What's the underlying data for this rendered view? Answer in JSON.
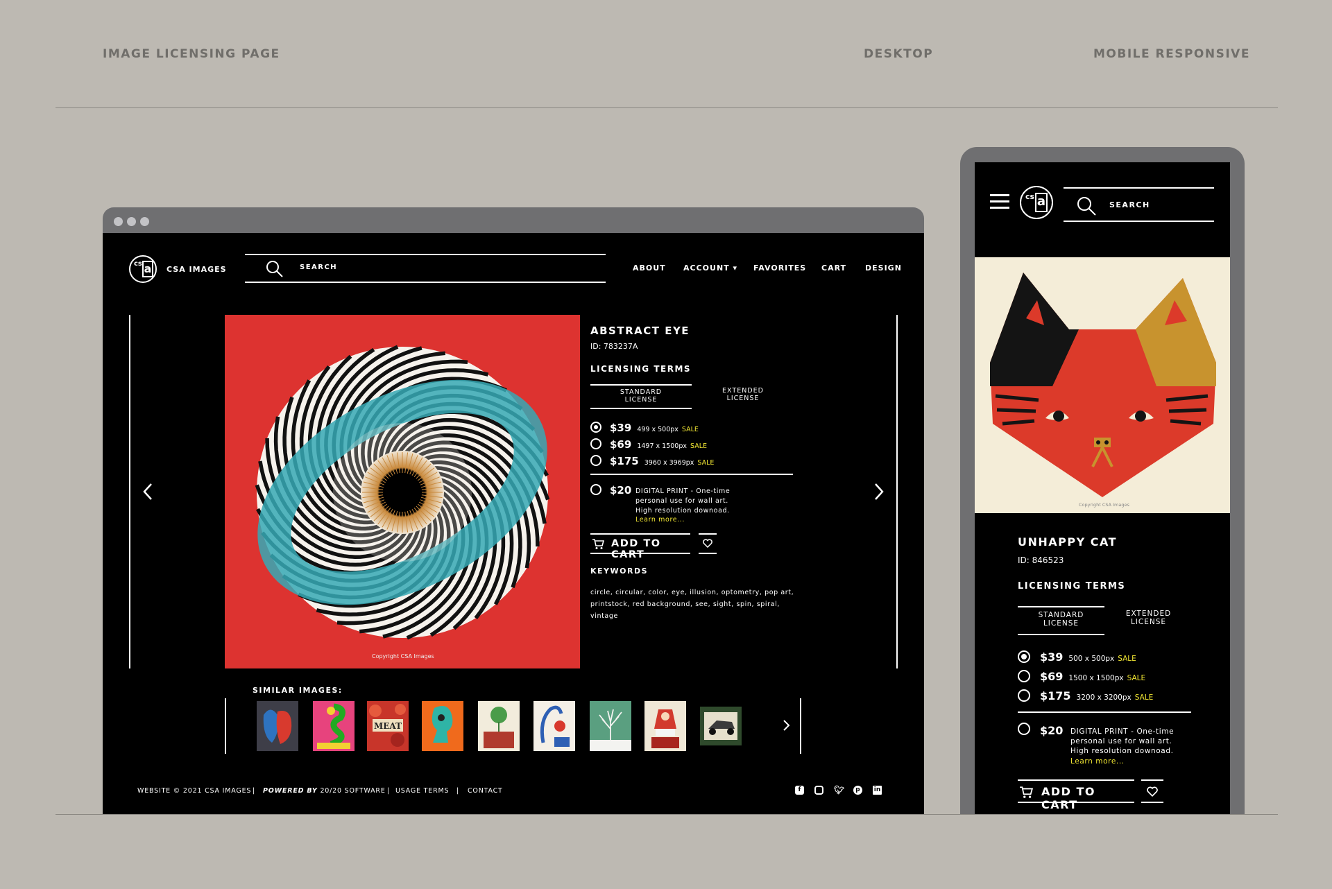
{
  "header": {
    "left": "IMAGE LICENSING PAGE",
    "center": "DESKTOP",
    "right": "MOBILE RESPONSIVE"
  },
  "brand": {
    "name": "CSA IMAGES",
    "cs": "cs",
    "a": "a"
  },
  "search": {
    "label": "SEARCH"
  },
  "nav": {
    "about": "ABOUT",
    "account": "ACCOUNT ▾",
    "favorites": "FAVORITES",
    "cart": "CART",
    "design": "DESIGN"
  },
  "desktop": {
    "title": "ABSTRACT EYE",
    "id": "ID: 783237A",
    "licensing": "LICENSING TERMS",
    "tab_standard": "STANDARD\nLICENSE",
    "tab_extended": "EXTENDED\nLICENSE",
    "options": [
      {
        "price": "$39",
        "size": "499 x 500px",
        "sale": "SALE",
        "selected": true
      },
      {
        "price": "$69",
        "size": "1497 x 1500px",
        "sale": "SALE",
        "selected": false
      },
      {
        "price": "$175",
        "size": "3960 x 3969px",
        "sale": "SALE",
        "selected": false
      }
    ],
    "print": {
      "price": "$20",
      "desc": "DIGITAL PRINT - One-time\npersonal use for wall art.\nHigh resolution downoad.",
      "learn": "Learn more..."
    },
    "add_to_cart": "ADD TO CART",
    "keywords_label": "KEYWORDS",
    "keywords": "circle, circular, color, eye, illusion, optometry, pop art,\nprintstock, red background, see, sight, spin, spiral,\nvintage",
    "copyright": "Copyright CSA Images",
    "similar_label": "SIMILAR IMAGES:",
    "similar": [
      "bull-rooster",
      "snake",
      "meat",
      "teal-bust",
      "plant-pot",
      "acrobat",
      "tree",
      "santa",
      "race-car"
    ]
  },
  "footer": {
    "website": "WEBSITE © 2021 CSA IMAGES",
    "sep": "|",
    "powered_em": "POWERED BY",
    "powered": "20/20 SOFTWARE",
    "usage": "USAGE TERMS",
    "contact": "CONTACT"
  },
  "social": [
    "facebook-icon",
    "instagram-icon",
    "twitter-icon",
    "pinterest-icon",
    "linkedin-icon"
  ],
  "mobile": {
    "title": "UNHAPPY CAT",
    "id": "ID: 846523",
    "licensing": "LICENSING TERMS",
    "tab_standard": "STANDARD\nLICENSE",
    "tab_extended": "EXTENDED\nLICENSE",
    "options": [
      {
        "price": "$39",
        "size": "500 x 500px",
        "sale": "SALE",
        "selected": true
      },
      {
        "price": "$69",
        "size": "1500 x 1500px",
        "sale": "SALE",
        "selected": false
      },
      {
        "price": "$175",
        "size": "3200 x 3200px",
        "sale": "SALE",
        "selected": false
      }
    ],
    "print": {
      "price": "$20",
      "desc": "DIGITAL PRINT - One-time\npersonal use for wall art.\nHigh resolution downoad.",
      "learn": "Learn more..."
    },
    "add_to_cart": "ADD TO CART",
    "copyright": "Copyright CSA Images"
  },
  "colors": {
    "background": "#bdb9b2",
    "screen": "#000000",
    "sale": "#f2e733",
    "art_red": "#dd3330",
    "teal": "#36a9b5"
  }
}
